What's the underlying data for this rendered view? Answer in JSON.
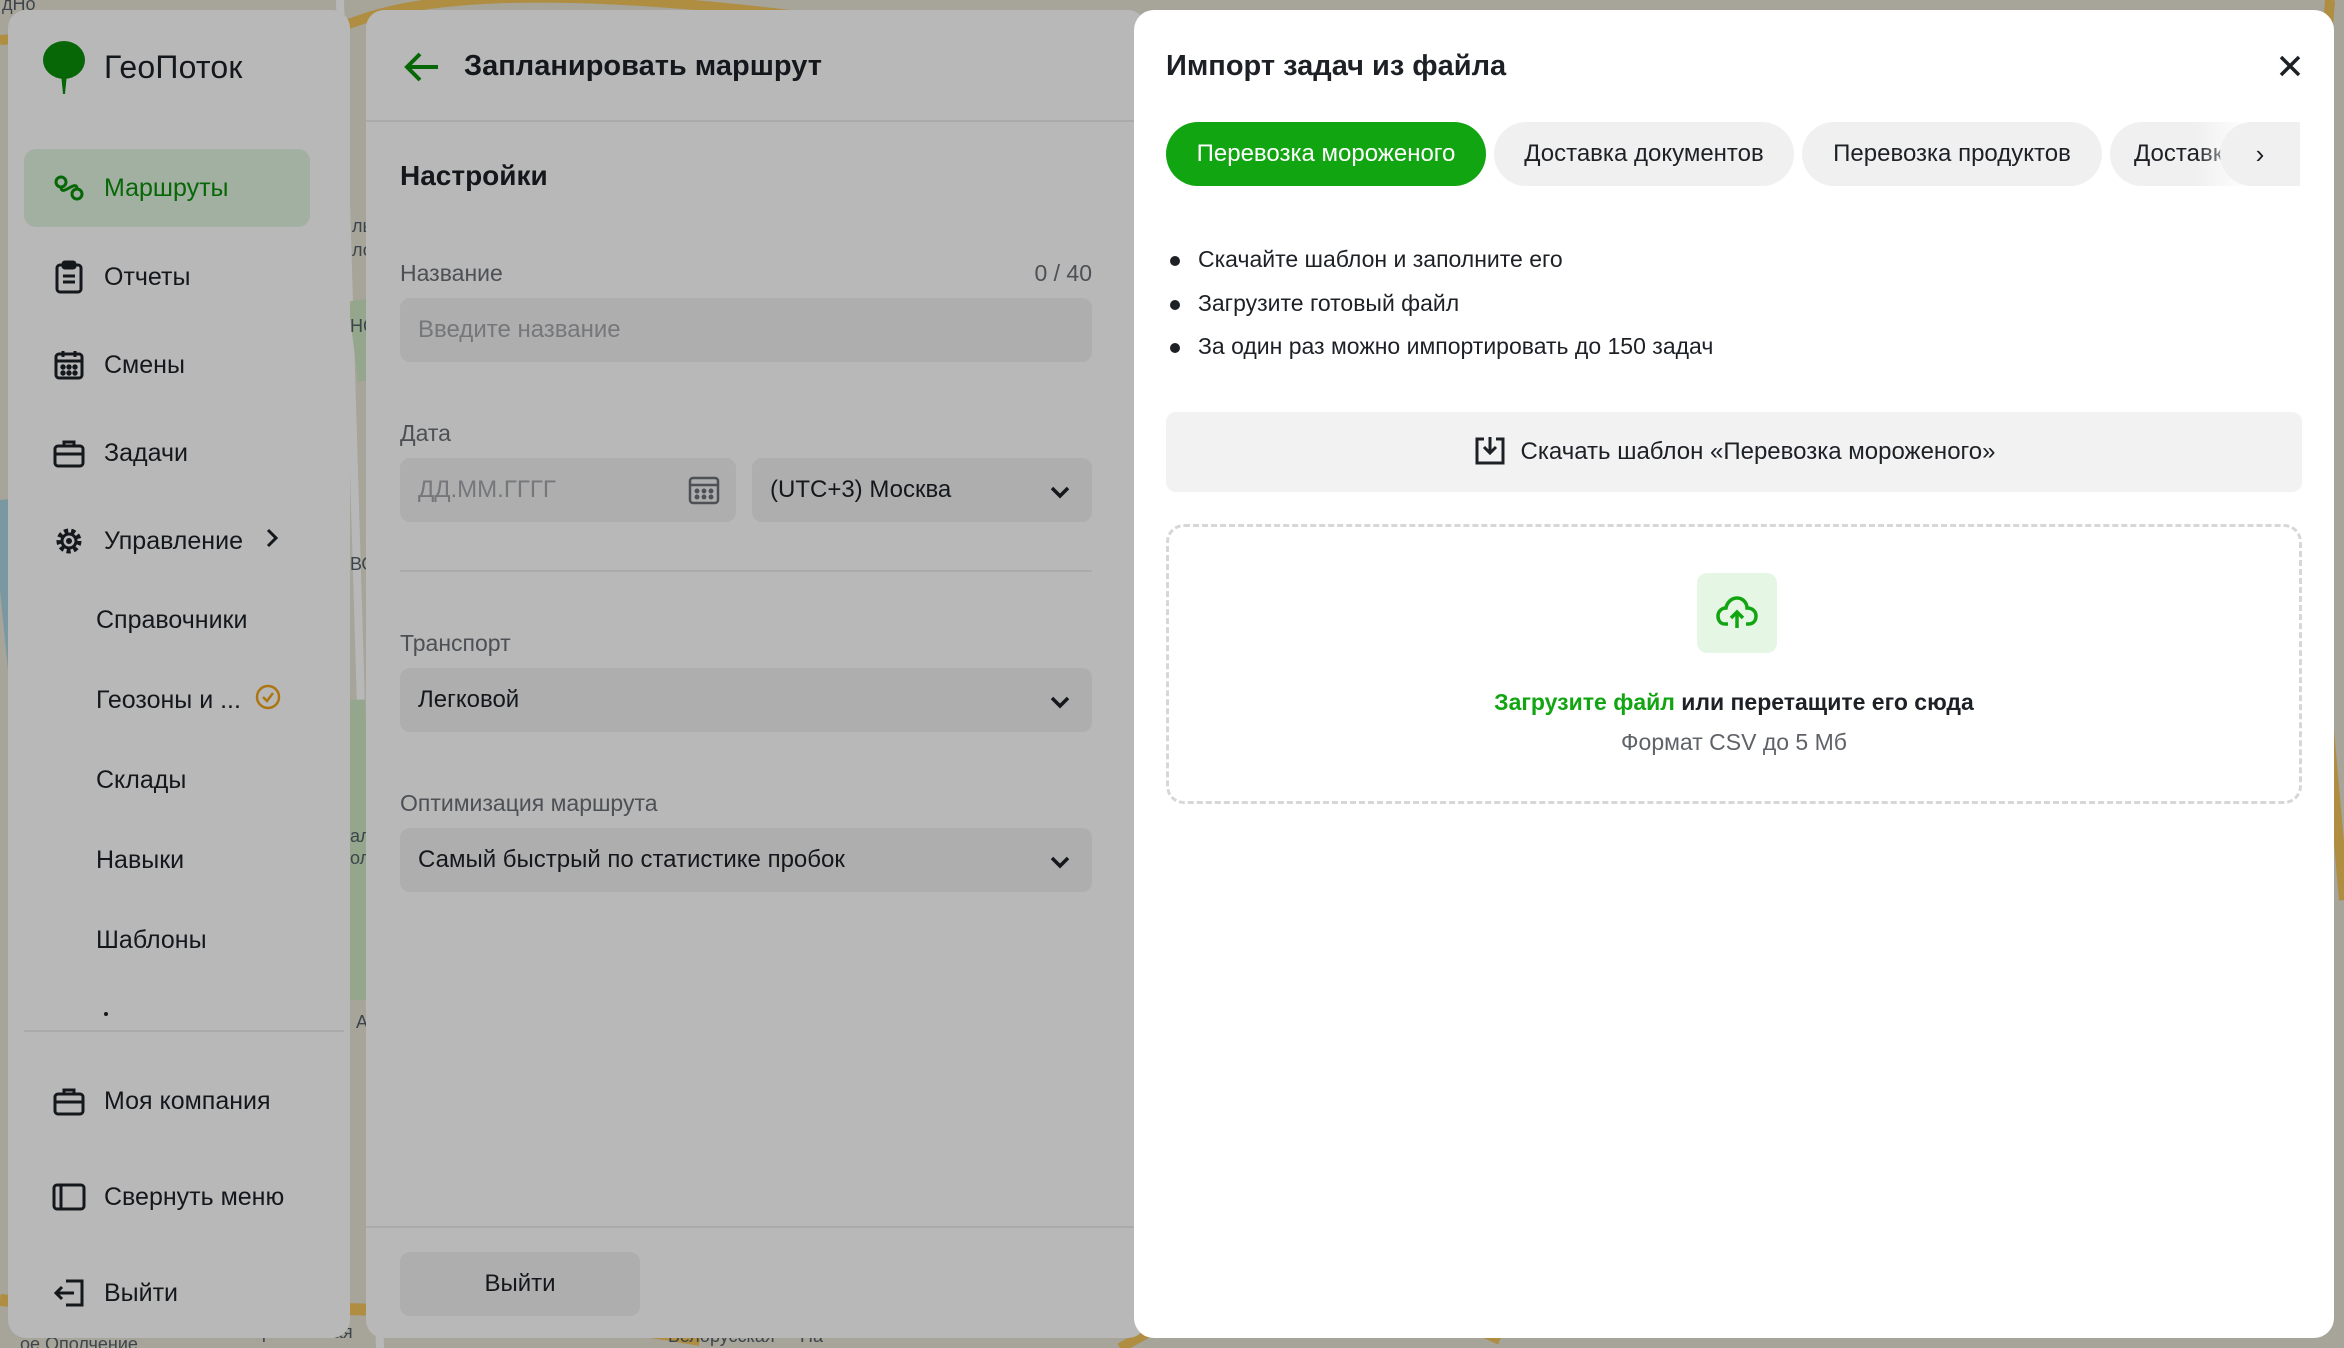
{
  "colors": {
    "accent": "#12a512",
    "active_nav_bg": "#dff4de",
    "overlay": "rgba(0,0,0,0.28)"
  },
  "map": {
    "labels": [
      "дНо",
      "ль",
      "ло",
      "НС",
      "ВО",
      "ал",
      "ол",
      "А",
      "Хорошевская",
      "ое Ополчение",
      "Белорусская",
      "На"
    ]
  },
  "sidebar": {
    "logo_text": "ГеоПоток",
    "items": [
      {
        "label": "Маршруты",
        "icon": "route-icon",
        "active": true
      },
      {
        "label": "Отчеты",
        "icon": "clipboard-icon"
      },
      {
        "label": "Смены",
        "icon": "calendar-icon"
      },
      {
        "label": "Задачи",
        "icon": "briefcase-icon"
      },
      {
        "label": "Управление",
        "icon": "gear-icon"
      }
    ],
    "sub_items": [
      "Справочники",
      "Геозоны и ...",
      "Склады",
      "Навыки",
      "Шаблоны"
    ],
    "bottom_items": [
      {
        "label": "Моя компания",
        "icon": "briefcase-icon"
      },
      {
        "label": "Свернуть меню",
        "icon": "collapse-icon"
      },
      {
        "label": "Выйти",
        "icon": "logout-icon"
      }
    ]
  },
  "plan_panel": {
    "title": "Запланировать маршрут",
    "section_title": "Настройки",
    "name_field": {
      "label": "Название",
      "placeholder": "Введите название",
      "counter": "0 / 40"
    },
    "date_field": {
      "label": "Дата",
      "placeholder": "ДД.ММ.ГГГГ",
      "timezone": "(UTC+3) Москва"
    },
    "transport_field": {
      "label": "Транспорт",
      "value": "Легковой"
    },
    "optimization_field": {
      "label": "Оптимизация маршрута",
      "value": "Самый быстрый по статистике пробок"
    },
    "exit_button": "Выйти"
  },
  "import_drawer": {
    "title": "Импорт задач из файла",
    "tabs": [
      "Перевозка мороженого",
      "Доставка документов",
      "Перевозка продуктов",
      "Доставка"
    ],
    "active_tab": "Перевозка мороженого",
    "next_arrow": "›",
    "instructions": [
      "Скачайте шаблон и заполните его",
      "Загрузите готовый файл",
      "За один раз можно импортировать до 150 задач"
    ],
    "download_button": "Скачать шаблон «Перевозка мороженого»",
    "dropzone": {
      "link_text": "Загрузите файл",
      "text": " или перетащите его сюда",
      "hint": "Формат CSV до 5 Мб"
    }
  }
}
